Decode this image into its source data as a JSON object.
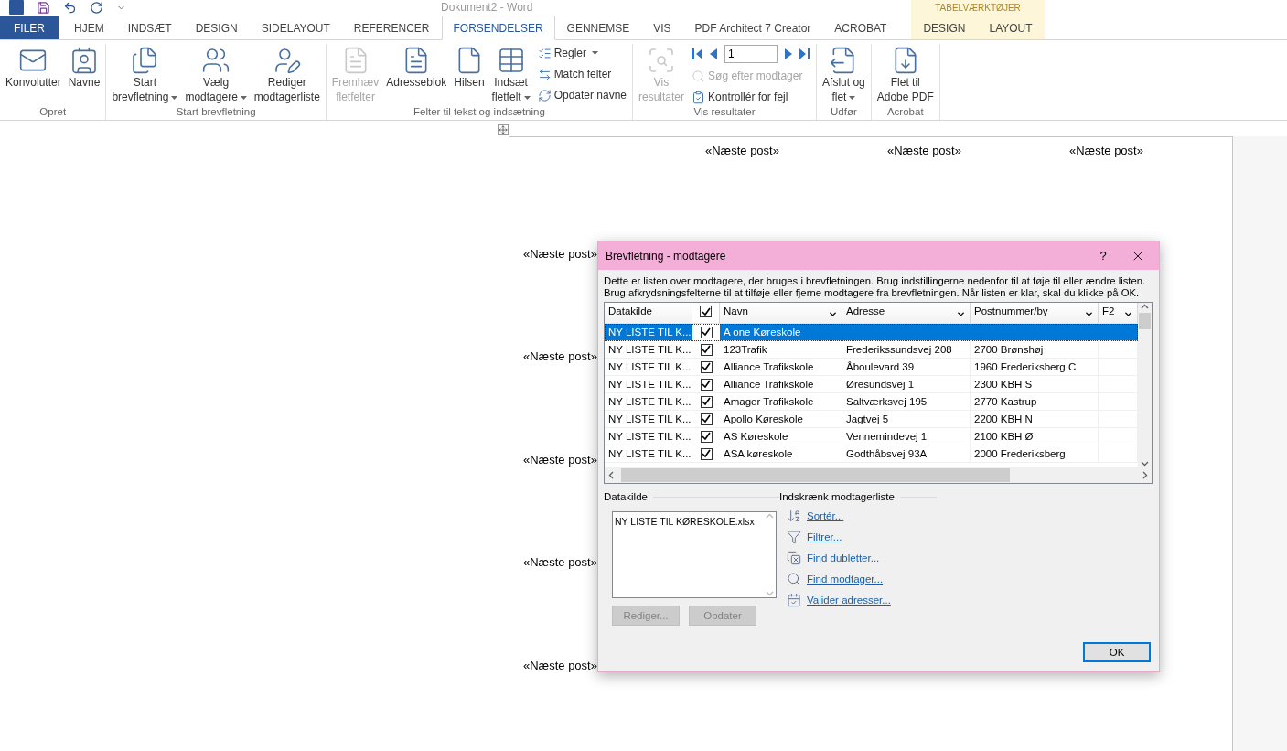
{
  "title_bar": {
    "title": "Dokument2 - Word"
  },
  "tabs": [
    {
      "label": "FILER",
      "kind": "file",
      "selected": false
    },
    {
      "label": "HJEM",
      "kind": "tab",
      "selected": false
    },
    {
      "label": "INDSÆT",
      "kind": "tab",
      "selected": false
    },
    {
      "label": "DESIGN",
      "kind": "tab",
      "selected": false
    },
    {
      "label": "SIDELAYOUT",
      "kind": "tab",
      "selected": false
    },
    {
      "label": "REFERENCER",
      "kind": "tab",
      "selected": false
    },
    {
      "label": "FORSENDELSER",
      "kind": "tab",
      "selected": true
    },
    {
      "label": "GENNEMSE",
      "kind": "tab",
      "selected": false
    },
    {
      "label": "VIS",
      "kind": "tab",
      "selected": false
    },
    {
      "label": "PDF Architect 7 Creator",
      "kind": "tab",
      "selected": false
    },
    {
      "label": "ACROBAT",
      "kind": "tab",
      "selected": false
    }
  ],
  "contextual_group": {
    "title": "TABELVÆRKTØJER",
    "tabs": [
      {
        "label": "DESIGN",
        "selected": false
      },
      {
        "label": "LAYOUT",
        "selected": false
      }
    ]
  },
  "ribbon": {
    "groups": [
      {
        "label": "Opret",
        "controls": [
          {
            "kind": "large",
            "lines": [
              "Konvolutter"
            ],
            "disabled": false
          },
          {
            "kind": "large",
            "lines": [
              "Navne"
            ],
            "disabled": false
          }
        ]
      },
      {
        "label": "Start brevfletning",
        "controls": [
          {
            "kind": "large",
            "lines": [
              "Start",
              "brevfletning"
            ],
            "dropdown": true,
            "disabled": false
          },
          {
            "kind": "large",
            "lines": [
              "Vælg",
              "modtagere"
            ],
            "dropdown": true,
            "disabled": false
          },
          {
            "kind": "large",
            "lines": [
              "Rediger",
              "modtagerliste"
            ],
            "disabled": false
          }
        ]
      },
      {
        "label": "Felter til tekst og indsætning",
        "controls": [
          {
            "kind": "large",
            "lines": [
              "Fremhæv",
              "fletfelter"
            ],
            "disabled": true
          },
          {
            "kind": "large",
            "lines": [
              "Adresseblok"
            ],
            "disabled": false
          },
          {
            "kind": "large",
            "lines": [
              "Hilsen"
            ],
            "disabled": false
          },
          {
            "kind": "large",
            "lines": [
              "Indsæt",
              "fletfelt"
            ],
            "dropdown": true,
            "disabled": false
          },
          {
            "kind": "small",
            "lines": [
              "Regler"
            ],
            "dropdown": true,
            "disabled": false
          },
          {
            "kind": "small",
            "lines": [
              "Match felter"
            ],
            "disabled": false
          },
          {
            "kind": "small",
            "lines": [
              "Opdater navne"
            ],
            "disabled": false
          }
        ]
      },
      {
        "label": "Vis resultater",
        "controls": [
          {
            "kind": "large",
            "lines": [
              "Vis",
              "resultater"
            ],
            "disabled": true
          },
          {
            "kind": "nav",
            "value": "1",
            "disabled": false
          },
          {
            "kind": "small",
            "lines": [
              "Søg efter modtager"
            ],
            "disabled": true
          },
          {
            "kind": "small",
            "lines": [
              "Kontrollér for fejl"
            ],
            "disabled": false
          }
        ]
      },
      {
        "label": "Udfør",
        "controls": [
          {
            "kind": "large",
            "lines": [
              "Afslut og",
              "flet"
            ],
            "dropdown": true,
            "disabled": false
          }
        ]
      },
      {
        "label": "Acrobat",
        "controls": [
          {
            "kind": "large",
            "lines": [
              "Flet til",
              "Adobe PDF"
            ],
            "disabled": false
          }
        ]
      }
    ]
  },
  "document": {
    "rows": [
      {
        "column_2": "«Næste post»",
        "column_3": "«Næste post»",
        "column_4": "«Næste post»"
      },
      {
        "column_1": "«Næste post»"
      },
      {
        "column_1": "«Næste post»"
      },
      {
        "column_1": "«Næste post»"
      },
      {
        "column_1": "«Næste post»"
      },
      {
        "column_1": "«Næste post»"
      }
    ]
  },
  "dialog": {
    "title": "Brevfletning - modtagere",
    "help": "?",
    "description": "Dette er listen over modtagere, der bruges i brevfletningen. Brug indstillingerne nedenfor til at føje til eller ændre listen. Brug afkrydsningsfelterne til at tilføje eller fjerne modtagere fra brevfletningen. Når listen er klar, skal du klikke på OK.",
    "table": {
      "columns": [
        {
          "kind": "text",
          "label": "Datakilde"
        },
        {
          "kind": "check",
          "checked": true
        },
        {
          "kind": "text",
          "label": "Navn",
          "filter": true
        },
        {
          "kind": "text",
          "label": "Adresse",
          "filter": true
        },
        {
          "kind": "text",
          "label": "Postnummer/by",
          "filter": true
        },
        {
          "kind": "text",
          "label": "F2",
          "filter": true
        }
      ],
      "rows": [
        {
          "source": "NY LISTE TIL K...",
          "checked": true,
          "name": "A one Køreskole",
          "selected": true
        },
        {
          "source": "NY LISTE TIL K...",
          "checked": true,
          "name": "123Trafik",
          "address": "Frederikssundsvej 208",
          "postal": "2700 Brønshøj",
          "selected": false
        },
        {
          "source": "NY LISTE TIL K...",
          "checked": true,
          "name": "Alliance Trafikskole",
          "address": "Åboulevard 39",
          "postal": "1960 Frederiksberg C",
          "selected": false
        },
        {
          "source": "NY LISTE TIL K...",
          "checked": true,
          "name": "Alliance Trafikskole",
          "address": "Øresundsvej 1",
          "postal": "2300 KBH S",
          "selected": false
        },
        {
          "source": "NY LISTE TIL K...",
          "checked": true,
          "name": "Amager Trafikskole",
          "address": "Saltværksvej 195",
          "postal": "2770 Kastrup",
          "selected": false
        },
        {
          "source": "NY LISTE TIL K...",
          "checked": true,
          "name": "Apollo Køreskole",
          "address": "Jagtvej 5",
          "postal": "2200 KBH N",
          "selected": false
        },
        {
          "source": "NY LISTE TIL K...",
          "checked": true,
          "name": "AS Køreskole",
          "address": "Vennemindevej 1",
          "postal": "2100 KBH Ø",
          "selected": false
        },
        {
          "source": "NY LISTE TIL K...",
          "checked": true,
          "name": "ASA køreskole",
          "address": "Godthåbsvej 93A",
          "postal": "2000 Frederiksberg",
          "selected": false
        }
      ]
    },
    "data_source": {
      "label": "Datakilde",
      "items": [
        "NY LISTE TIL KØRESKOLE.xlsx"
      ],
      "buttons": [
        {
          "label": "Rediger...",
          "disabled": true
        },
        {
          "label": "Opdater",
          "disabled": true
        }
      ]
    },
    "refine": {
      "label": "Indskrænk modtagerliste",
      "links": [
        "Sortér...",
        "Filtrer...",
        "Find dubletter...",
        "Find modtager...",
        "Valider adresser..."
      ]
    },
    "ok": "OK"
  }
}
